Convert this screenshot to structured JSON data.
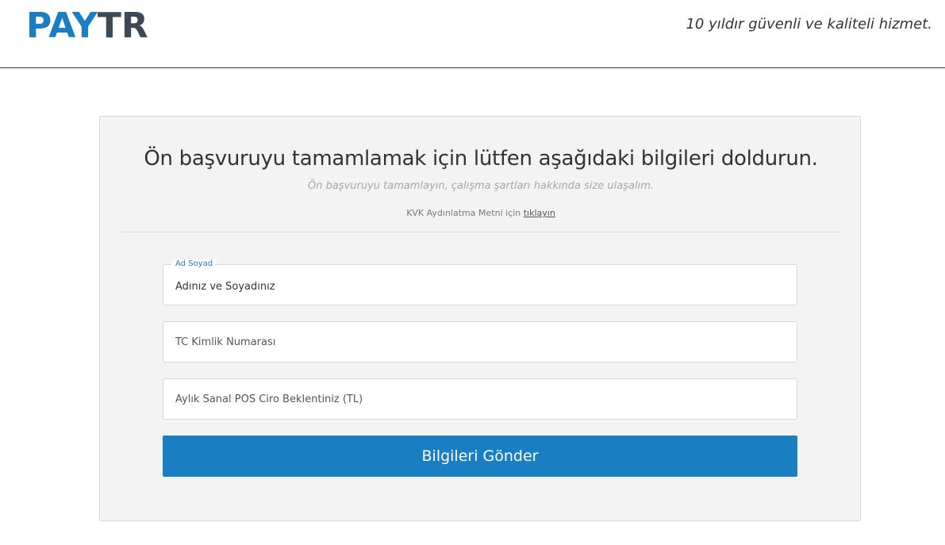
{
  "header": {
    "logo_pay": "PAY",
    "logo_tr": "TR",
    "tagline": "10 yıldır güvenli ve kaliteli hizmet."
  },
  "form": {
    "title": "Ön başvuruyu tamamlamak için lütfen aşağıdaki bilgileri doldurun.",
    "subtitle": "Ön başvuruyu tamamlayın, çalışma şartları hakkında size ulaşalım.",
    "kvk_text": "KVK Aydınlatma Metni için",
    "kvk_link": "tıklayın",
    "fields": [
      {
        "label": "Ad Soyad",
        "value": "Adınız ve Soyadınız",
        "placeholder": ""
      },
      {
        "label": "",
        "value": "",
        "placeholder": "TC Kimlik Numarası"
      },
      {
        "label": "",
        "value": "",
        "placeholder": "Aylık Sanal POS Ciro Beklentiniz (TL)"
      }
    ],
    "submit_label": "Bilgileri Gönder"
  },
  "colors": {
    "brand_blue": "#1a7ec2",
    "brand_dark": "#3d4a55",
    "card_bg": "#f3f3f3"
  }
}
